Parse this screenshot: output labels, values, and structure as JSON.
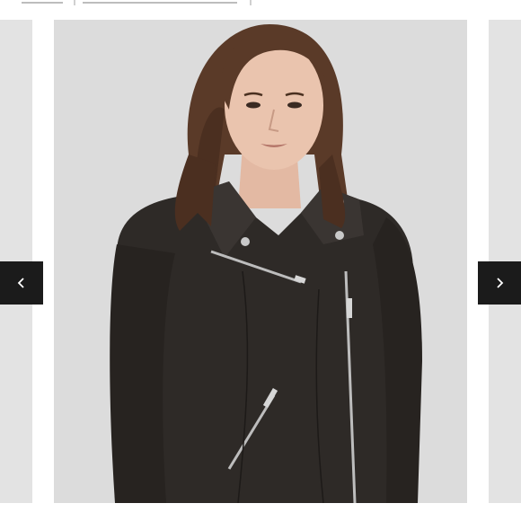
{
  "thumbnails": {
    "count": 2
  },
  "carousel": {
    "current_slide_alt_icon": "product-photo",
    "prev_icon": "chevron-left-icon",
    "next_icon": "chevron-right-icon"
  },
  "colors": {
    "nav_button_bg": "#1b1b1b",
    "nav_button_icon": "#ffffff",
    "slide_background": "#dcdcdc",
    "jacket": "#2e2a27"
  }
}
